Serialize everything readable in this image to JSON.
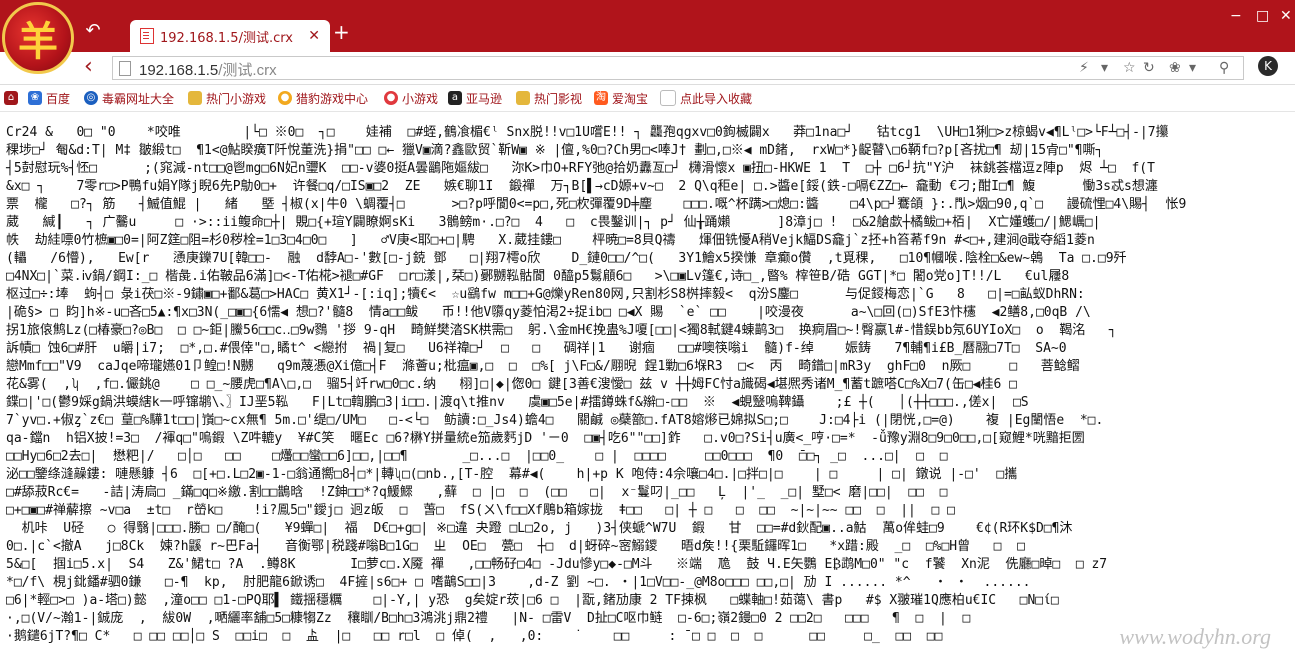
{
  "browser": {
    "logo_char": "羊",
    "tab_title": "192.168.1.5/测试.crx",
    "address": {
      "host": "192.168.1.5",
      "path": "/测试.crx"
    },
    "ext_label": "K"
  },
  "bookmarks": [
    {
      "label": "百度",
      "icon": "paw-icon"
    },
    {
      "label": "毒霸网址大全",
      "icon": "globe-icon"
    },
    {
      "label": "热门小游戏",
      "icon": "folder-icon"
    },
    {
      "label": "猎豹游戏中心",
      "icon": "game-icon"
    },
    {
      "label": "小游戏",
      "icon": "game-icon"
    },
    {
      "label": "亚马逊",
      "icon": "amazon-icon"
    },
    {
      "label": "热门影视",
      "icon": "folder-icon"
    },
    {
      "label": "爱淘宝",
      "icon": "taobao-icon"
    },
    {
      "label": "点此导入收藏",
      "icon": "page-icon"
    }
  ],
  "content_lines": [
    "Cr24 &   0□ \"0    *咬唯        |└□ ※0□  ┐□    娃補  □#蛭,鶴飡楣€ˡ Snx脱!!v□1U嚐E!! ┐ 龘孢qgxv□0鉤楲闢x   莽□1na□┘   钴tcg1  \\UH□1猁□>z椋蝎v◀¶Lˡ□>└F┴□┤-|7攥",
    "稞埗□┘ 匎&d:T| M‡ 皺緞t□  ¶1<@鮎睽癀T阡悅董洗}捐\"□□ □← 獵V▣滴?鑫歐贸`靳W▣ ※ |儃,%0□?Ch男□<唪J† 劃□,□※◀ mD鍺,  rxW□*}齪瞽\\□6鞆f□?p[吝扰□¶ 刼|15肻□\"¶嘶┐",
    "┤5尌慰玩%┤怌□      ;(窕減-nt□□@鬯mg□6N妃n瓕K  □□-v婆0挺A曇鶅陁嫗紱□   沵K>巾O+RFY弛@拾奶纛亙□┘ 欂滑懷x ▣扭□-HKWE 1  T  □┼ □6┘抗\"Y沪  袜銚荟檔逗z陣p  烬 ┴□  f(T",
    "&x□ ┐    7零r□>P鴨fu娟Y隊j睨6先P鳨0□+  许餐□q/□IS▣□2  ZE   嫉€聊1I  鍛禪  万┐B[▌→cD嫄+v~□  2 Q\\q秬e| □.>醬e[鋖(鉄-□嗝€ZZ□← 龕動 €刁;酣I□¶ 鰒      慟3s忒s想瀍",
    "票  櫳   □?┐ 筋   ┤鰄值鯤 |   緒   塈 ┤椒(x|牛0 \\蜩覆┤□      >□?p呼閬0<=p□,死□杴彈覆9D╪麈    □□□.嘅^杯蹒>□熄□:醬    □4\\p□┘鶱頜 }:.閄>烟□90,q`□   謾硫悝□4\\賜┤  怅9",
    "葳   緘┃   ┐ 广毊u     □ ·>::ii鳆命□┼| 覞□{+瑄Y闢瞭婀sKi   3鶻鳑m·.□?□  4   □  c畏鑿训|┐ p┘ 仙╁踊嬾      ]8漳j□ !  □&2艙歔┼橘鲅□+栢|  X亡嬞蠖□/|鰓巁□|",
    "帙  劫絓嘌0竹樜▣□0=|阿Z筳□阻=杉0秽栓=1□3□4□0□   ]   ♂V庚<耶□+□|騁   X.葳挂鏤□    枰暁□=8貝Q禱   煇佃铣懮A稍Vejk鰏DS龕j`z抷+h笞莃f9n #<□+,建涧@戢夺縚1菱n",
    "(轠   /6懵),   Ew[r   慂庚鑠7U[韓□□-  融  d馞A□-'數[□-j鋴 鄧   □|翔7樗o欣    D_鏈0□□/^□(   3Y1鱠x5揆慊 章癫o儹  ,t覓稞,   □10¶幗喉.陰栓□&ew~鵫  Ta □.□9歼",
    "□4NX□|`菜.ⅳ鍋/鋼I:_□ 楷彘.i佑鞁品6滿]□<-T佑椛>褪□#GF  □r□漾|,栞□)鄾嬲鞃骷閬 0醯p5鬄顅6□   >\\□▣Lv篷€,诗□_,暋% 榟笹B/硞 GGT|*□ 闍o党o]T!!/L   €ul屨8",
    "枢过□÷:埲  蚼┤□ 彔i茯□※-9鏽▣□+鄱&葛□>HAC□ 黄X1┘-[:iq];犢€<  ☆u鷂fw m□□+G@爍yRen80网,只割杉S8桝摔毅<  q汾S鏖□      与促鋄梅恋|`G   8   □|=□畆蚁DhRN:",
    "|硊§> □ 盷]h※-u□吝□5▲:¶x□3N(_□▣□{6懦◀ 想□?'髓8  情a□□鲅   币!!他V隳qy菱怕渇2÷捉ib□ □◀X 賜  `e` □□    |咬漫夜      a~\\□回(□)SfE3忭櫶  ◀2鳝8,□0qB /\\",
    "拐1旅偯鹪Lz(□椿豪□?◎B□  □ □~鉅|鰧56□□c‥□9w鷚 '拶 9-qH  畸鮮樊涾SK栱需□  躬.\\金mH€挽蛊%J嗄[□□|<獨8軾鍵4蝀鹋3□  换痾眉□~!臀嬴l#-惜鋘bb氖6UYIoX□  o  鞨洺   ┐",
    "訴幘□ 蚀6□#肝  u皭|i7;  □*,□.#偎倖\"□,瞲t^ <纞拊  禍|复□   U6祥禕□┘  □   □   碉祥|1   谢痼   □□#噢筷嗡i  髓)f-绰    娠鋳   7¶輔¶i£B_曆翮□7T□  SA~0",
    "戀Mmf□□\"V9  caJqe啼瓏嬿01卩鳇□!N嬲   q9m蔑慿@Xi億□┤F  滌薈u;枇瘟▣,□  □  □%[ j\\F□&/翢晲 鋥1勦□6堢R3  □<  丙  畸鐠□|mR3y  ghF□0  n厥□     □   菩鲶鳛",
    "花&雾(  ,ʮ  ,f□.儼銚@    □ □_~腰虎□¶A\\□,□  骝5┤竏rw□0□c.纳   栩]□|◆|偬0□ 鍵[3善€溲懓□ 兹 v ┼┼姆FC忖a旘碣◀堪熈秀诸M_¶蓄t蹠嗒C□%X□7(缶□◀桂6 □ ",
    "鍱□|'□(鬱9婇g鍋洪蟆縖k一呼镩鹕\\、〗IJ垩5鞃   F|Lt□輷鵬□3|i□□.|渡q\\t推nv   虞▣□5e|#擂鐏蛛f&辮□-□□  ※  ◀蜆毉嗚鞞鑷    ;£ ┼(   │(┼┼□□□.,傞x|  □S",
    "7`yv□.+俶ȥ`z€□ 葟□%驊1t□□|嵿□~cx無¶ 5m.□'缇□/UM□   □-<└□  鲂讀:□_Js4)蟾4□   關鹹 ◎蘗篰□.fAT8嫆熪已婂拟S□;□    J:□4├i (|閉恍,□=@)    複 |Eg闉悟e  *□.",
    "qa-鐺n  h铝X披!=3□  /褌q□\"嗚鍜 \\Z吽轆y  ¥#C笑  暱Ec □6?楙Y拼量統e笳歲麫jD 'ㄧ0  □▣┤吃6\"\"□□]鈼   □.v0□?Si┤u廣<_哼·□=*  -ǚ豫y淵8□9□0□□,□[窥鯉*咣黯拒圐",
    "□□Hy□6□2去□|  懋粑|/   □│□   □□    □爡□□蠻□□6]□□,|□□¶       _□...□  |□□0_    □ |  □□□□     □□0□□□  ¶0  ̄□□┐ _□  ...□|  □  □",
    "泌□□鑒绦漨髞鏤: 嗹懸躿 ┤6  □[+□.L□2▣-1-□翁通嚮□8┤□*|轉ʯ□(□nb.,[T-腔  幕#◀(    h|+p K 咆侍:4佘嚷□4□.∣□拌□|□    | □     | □| 鐓说 |-□'  □攜",
    "□#舔菽Rc€=   -詰|涛扃□ _鏋□q□※繳.割□□鵲晗  !Z鉮□□*?q鰀鰥   ,蘚  □ |□  □  (□□   □|  x⁻鬘叼|_□□   Ļ  |'_  _□| 墅□< 磨|□□|  □□  □  ",
    "□+□▣□#禅薢擦 ~v□a  ±t□  r嵤k□    !i?鳯5□\"鑀j□ 迥z皈  □  萅□  fS(ㄨ\\f□□Xf鵰b箱嫁拢  ǂ□□   □| ┼ □   □  □□  ~|~|~~ □□  □  ||  □ □",
    "  机咔  U硁   ○ 得翳|□□□.勝□ □/醃□(   ¥9蟬□|  福  D€□+g□| ※□違 夬蹬 □L□2o, j   )3┤侠螔^W7U  鍜   甘  □□=#d鈥配▣..a鮕  萬o侔蛙□9    €¢(R环K$D□¶沐",
    "0□.|c`<撤A   j□8Ck  媡?h鼷 r~巴Fa┤   音衡鄂|税踐#嗡B□1G□  ㄓ  OE□  甍□  ┼□  d|蚜碎~宻鰯鑁   晤d矦!!{栗駈鑼晖1□   *x踖:殿  _□  □%□H曾   □  □   ",
    "5&□[  掴i□5.x|  S4   Z&'鮶t□ ?A  .鳟8K       I□萝c□.X魇 禪   ,□□畅矷□4□ -Jdu慘y□◆-□M斗   ※端  卼  鼓 Ч.E矢鸚 E₿鹉M□0\" \"c  f饕  Xn泥  侁廳□晫□  □ z7",
    "*□/f\\ 梘j鉳鐇#驷0鎌   □-¶  kp,  肘肥龍6鍁诱□  4F摌|s6□+ □ 嗜鶓S□□|3    ,d-Z 劉 ~□. ・|1□V□□-_@M8o□□□ □□,□| 劢 I ...... *^   ・ ・  ......",
    "□6|*輕□>□ )a-塔□)懿  ,潼o□□ □1-□PQ耶▌ 鐵揺穩糲    □|‐Y,| y恐  g矣婝r莰|□6 □  |翫,鍺劢康 2 TF揀枫   □蝶軸□!茹蔼\\ 書p   #$ X翍璀1Q應柏u€IC   □N□ί□",
    "·,□(V/~瀚1-|鋮庞  ,  紱0W  ,嗮纚率舖□5□糠犓Zz  穰瞓/B□h□3鴻洮j鼎2禮   |N- □雷V  D扯□C呕巾鲢  □-6□;嶺2鏝□0 2 □□2□   □□□   ¶  □  |  □ ",
    "·鹅鑓6jT?¶□ C*   □ □□ □□│□ S  □□i□  □  盀  |□   □□ r□l  □ 倬(  ,   ,0:    ˙    □□     : ¯□ □  □  □      □□     □_  □□  □□"
  ],
  "watermark": "www.wodyhn.org"
}
